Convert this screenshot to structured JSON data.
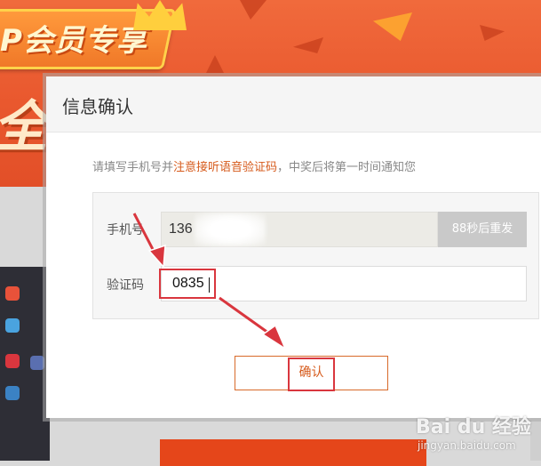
{
  "background": {
    "banner_text": "P会员专享",
    "headline_text": "全网",
    "accent_color": "#e9582e",
    "panel_color": "#2e2e36"
  },
  "modal": {
    "title": "信息确认",
    "notice_prefix": "请填写手机号并",
    "notice_highlight": "注意接听语音验证码",
    "notice_suffix": "，中奖后将第一时间通知您",
    "highlight_color": "#d65a1b",
    "phone": {
      "label": "手机号",
      "value": "136",
      "resend_label": "88秒后重发"
    },
    "code": {
      "label": "验证码",
      "value": "0835"
    },
    "confirm_label": "确认"
  },
  "annotation": {
    "marker_color": "#d9363e"
  },
  "watermark": {
    "logo": "Bai du 经验",
    "url": "jingyan.baidu.com"
  }
}
